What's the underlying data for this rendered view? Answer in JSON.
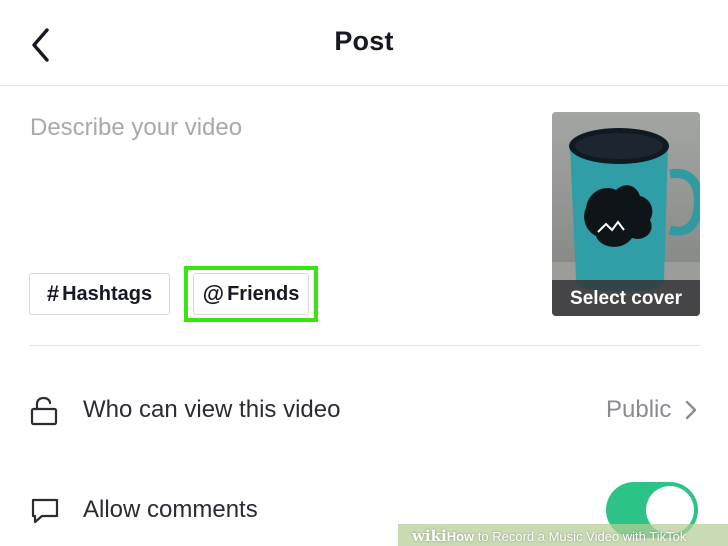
{
  "header": {
    "title": "Post"
  },
  "description": {
    "placeholder": "Describe your video"
  },
  "chips": {
    "hashtags": {
      "symbol": "#",
      "label": "Hashtags"
    },
    "friends": {
      "symbol": "@",
      "label": "Friends"
    }
  },
  "cover": {
    "label": "Select cover"
  },
  "rows": {
    "privacy": {
      "label": "Who can view this video",
      "value": "Public",
      "icon": "lock-icon"
    },
    "comments": {
      "label": "Allow comments",
      "icon": "comment-icon",
      "enabled": true
    }
  },
  "colors": {
    "highlight": "#39e511",
    "toggle_on": "#2cc486",
    "placeholder": "#a8a9ad"
  },
  "watermark": {
    "brand": "wiki",
    "how": "How",
    "rest": " to Record a Music Video with TikTok"
  }
}
